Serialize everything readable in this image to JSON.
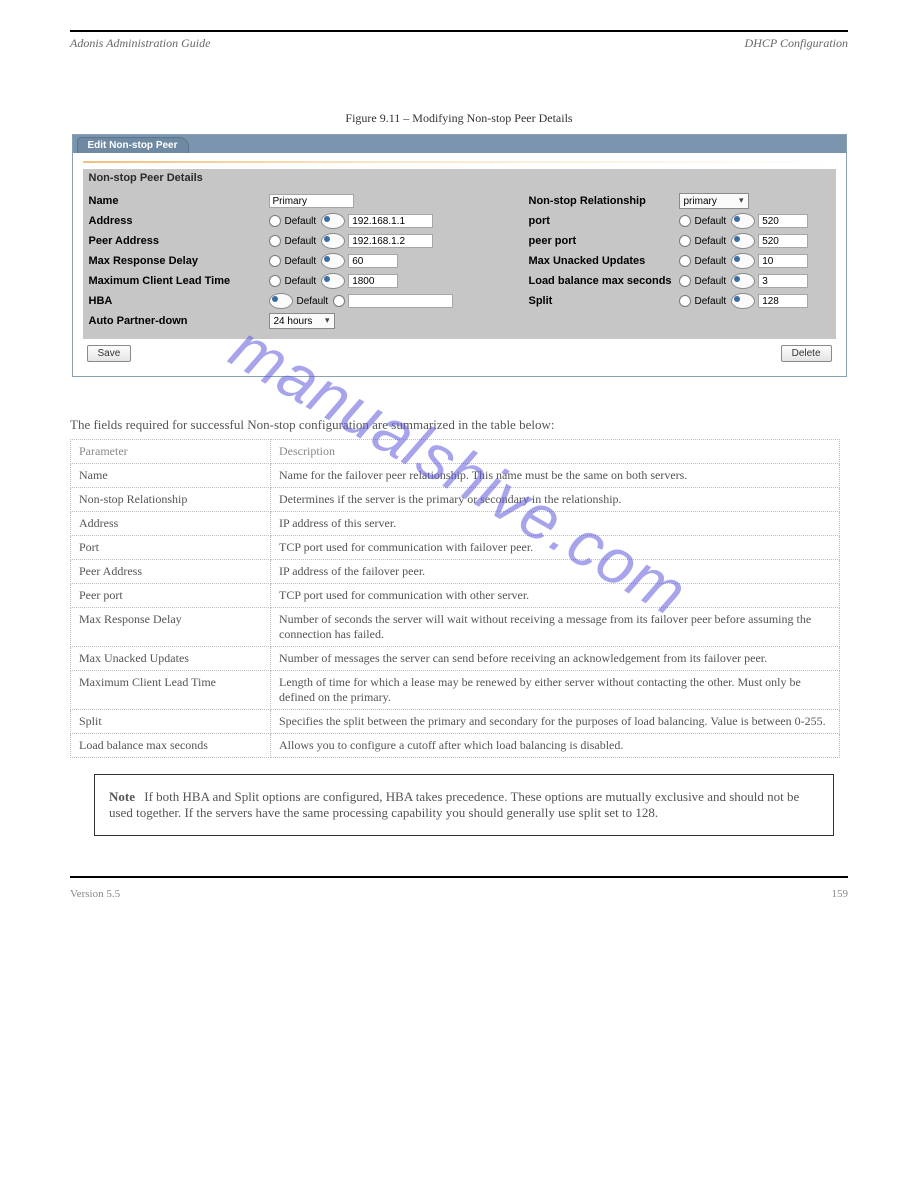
{
  "header": {
    "left": "Adonis Administration Guide",
    "right": "DHCP Configuration"
  },
  "figure": {
    "caption": "Figure 9.11 – Modifying Non-stop Peer Details"
  },
  "panel": {
    "tab": "Edit Non-stop Peer",
    "section_title": "Non-stop Peer Details",
    "left": {
      "name_label": "Name",
      "name_value": "Primary",
      "address_label": "Address",
      "peer_address_label": "Peer Address",
      "max_response_label": "Max Response Delay",
      "max_client_lead_label": "Maximum Client Lead Time",
      "hba_label": "HBA",
      "auto_partner_label": "Auto Partner-down",
      "default_text": "Default",
      "address_value": "192.168.1.1",
      "peer_address_value": "192.168.1.2",
      "max_response_value": "60",
      "max_client_lead_value": "1800",
      "auto_partner_value": "24 hours"
    },
    "right": {
      "relationship_label": "Non-stop Relationship",
      "relationship_value": "primary",
      "port_label": "port",
      "port_value": "520",
      "peer_port_label": "peer port",
      "peer_port_value": "520",
      "max_unacked_label": "Max Unacked Updates",
      "max_unacked_value": "10",
      "load_balance_label": "Load balance max seconds",
      "load_balance_value": "3",
      "split_label": "Split",
      "split_value": "128",
      "default_text": "Default"
    },
    "buttons": {
      "save": "Save",
      "delete": "Delete"
    }
  },
  "desc": "The fields required for successful Non-stop configuration are summarized in the table below:",
  "table": {
    "head": {
      "c1": "Parameter",
      "c2": "Description"
    },
    "rows": [
      {
        "c1": "Name",
        "c2": "Name for the failover peer relationship. This name must be the same on both servers."
      },
      {
        "c1": "Non-stop Relationship",
        "c2": "Determines if the server is the primary or secondary in the relationship."
      },
      {
        "c1": "Address",
        "c2": "IP address of this server."
      },
      {
        "c1": "Port",
        "c2": "TCP port used for communication with failover peer."
      },
      {
        "c1": "Peer Address",
        "c2": "IP address of the failover peer."
      },
      {
        "c1": "Peer port",
        "c2": "TCP port used for communication with other server."
      },
      {
        "c1": "Max Response Delay",
        "c2": "Number of seconds the server will wait without receiving a message from its failover peer before assuming the connection has failed."
      },
      {
        "c1": "Max Unacked Updates",
        "c2": "Number of messages the server can send before receiving an acknowledgement from its failover peer."
      },
      {
        "c1": "Maximum Client Lead Time",
        "c2": "Length of time for which a lease may be renewed by either server without contacting the other. Must only be defined on the primary."
      },
      {
        "c1": "Split",
        "c2": "Specifies the split between the primary and secondary for the purposes of load balancing. Value is between 0-255."
      },
      {
        "c1": "Load balance max seconds",
        "c2": "Allows you to configure a cutoff after which load balancing is disabled."
      }
    ]
  },
  "note": {
    "head": "Note",
    "body": "If both HBA and Split options are configured, HBA takes precedence. These options are mutually exclusive and should not be used together. If the servers have the same processing capability you should generally use split set to 128."
  },
  "footer": {
    "left": "Version 5.5",
    "right": "159"
  },
  "watermark": "manualshive.com"
}
